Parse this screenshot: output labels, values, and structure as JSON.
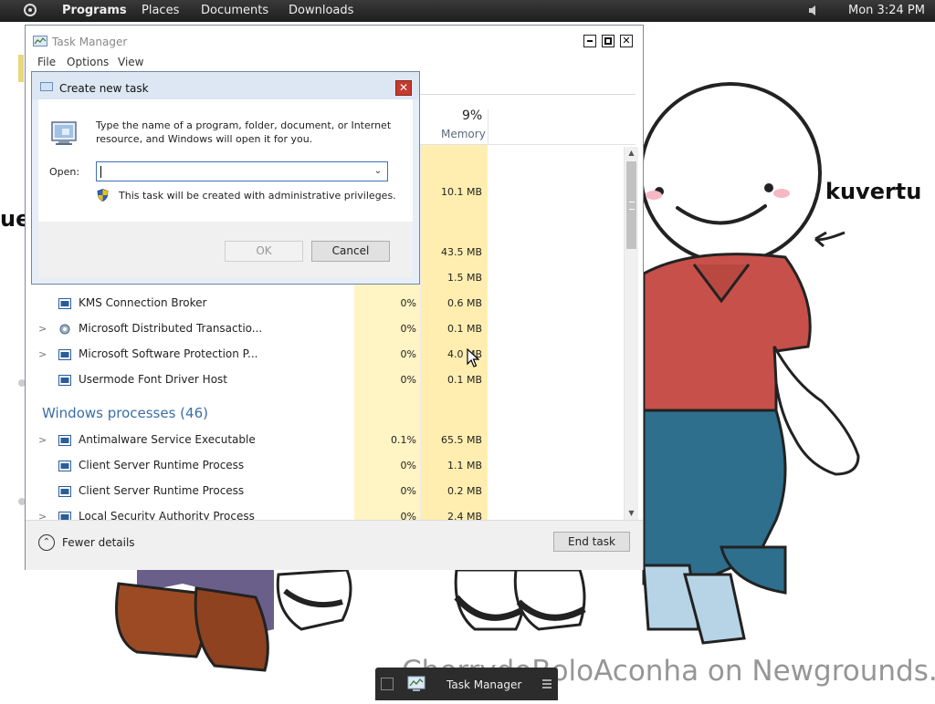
{
  "top_panel": {
    "menus": [
      "Programs",
      "Places",
      "Documents",
      "Downloads"
    ],
    "clock": "Mon  3:24 PM"
  },
  "wallpaper": {
    "name_label": "kuvertu",
    "left_fragment": "ue",
    "watermark": "CherrydoBoloAconha on Newgrounds."
  },
  "task_manager": {
    "title": "Task Manager",
    "menu": [
      "File",
      "Options",
      "View"
    ],
    "memory_header": {
      "percent": "9%",
      "label": "Memory"
    },
    "upper_memory_values": [
      "10.1 MB",
      "43.5 MB",
      "1.5 MB"
    ],
    "background_rows": [
      {
        "expand": "",
        "name": "KMS Connection Broker",
        "cpu": "0%",
        "memory": "0.6 MB"
      },
      {
        "expand": ">",
        "name": "Microsoft Distributed Transactio...",
        "cpu": "0%",
        "memory": "0.1 MB"
      },
      {
        "expand": ">",
        "name": "Microsoft Software Protection P...",
        "cpu": "0%",
        "memory": "4.0 MB"
      },
      {
        "expand": "",
        "name": "Usermode Font Driver Host",
        "cpu": "0%",
        "memory": "0.1 MB"
      }
    ],
    "windows_section_title": "Windows processes (46)",
    "windows_rows": [
      {
        "expand": ">",
        "name": "Antimalware Service Executable",
        "cpu": "0.1%",
        "memory": "65.5 MB"
      },
      {
        "expand": "",
        "name": "Client Server Runtime Process",
        "cpu": "0%",
        "memory": "1.1 MB"
      },
      {
        "expand": "",
        "name": "Client Server Runtime Process",
        "cpu": "0%",
        "memory": "0.2 MB"
      },
      {
        "expand": ">",
        "name": "Local Security Authority Process",
        "cpu": "0%",
        "memory": "2.4 MB"
      }
    ],
    "fewer_details_label": "Fewer details",
    "end_task_label": "End task"
  },
  "run_dialog": {
    "title": "Create new task",
    "description": "Type the name of a program, folder, document, or Internet resource, and Windows will open it for you.",
    "open_label": "Open:",
    "open_value": "",
    "admin_note": "This task will be created with administrative privileges.",
    "ok_label": "OK",
    "cancel_label": "Cancel"
  },
  "taskbar": {
    "active_item": "Task Manager"
  },
  "colors": {
    "cpu_column": "#fff4c4",
    "memory_column": "#ffeeb0",
    "section_heading": "#3a6ea5",
    "dialog_close": "#c53b2e"
  }
}
